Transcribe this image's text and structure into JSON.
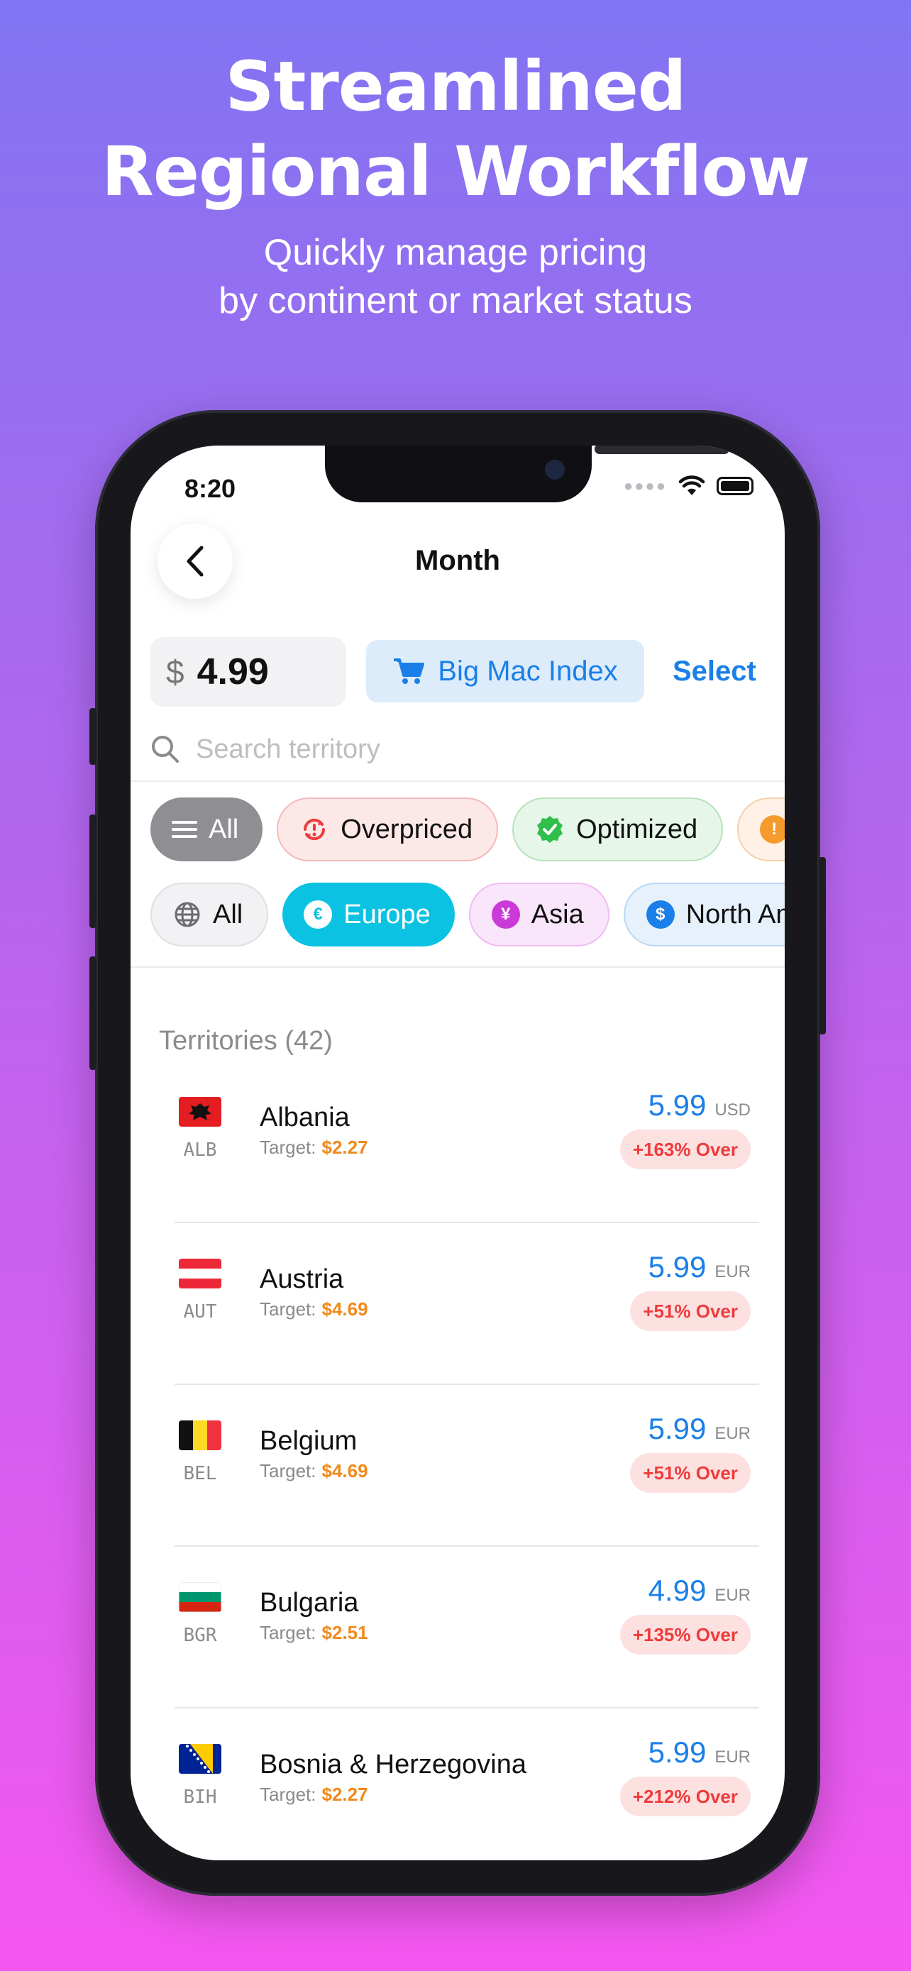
{
  "marketing": {
    "headline_line1": "Streamlined",
    "headline_line2": "Regional Workflow",
    "subline_line1": "Quickly manage pricing",
    "subline_line2": "by continent or market status"
  },
  "status_bar": {
    "time": "8:20"
  },
  "nav": {
    "title": "Month"
  },
  "price": {
    "currency_symbol": "$",
    "value": "4.99"
  },
  "big_mac_button": {
    "label": "Big Mac Index"
  },
  "select_button": {
    "label": "Select"
  },
  "search": {
    "placeholder": "Search territory"
  },
  "status_filters": [
    {
      "label": "All",
      "selected": true
    },
    {
      "label": "Overpriced"
    },
    {
      "label": "Optimized"
    }
  ],
  "region_filters": [
    {
      "label": "All"
    },
    {
      "label": "Europe",
      "selected": true,
      "icon_glyph": "€"
    },
    {
      "label": "Asia",
      "icon_glyph": "¥"
    },
    {
      "label": "North Am",
      "icon_glyph": "$"
    }
  ],
  "territories_header": "Territories (42)",
  "territories": [
    {
      "flag": "albania",
      "code": "ALB",
      "name": "Albania",
      "target_label": "Target:",
      "target": "$2.27",
      "price": "5.99",
      "currency": "USD",
      "status": "+163% Over"
    },
    {
      "flag": "austria",
      "code": "AUT",
      "name": "Austria",
      "target_label": "Target:",
      "target": "$4.69",
      "price": "5.99",
      "currency": "EUR",
      "status": "+51% Over"
    },
    {
      "flag": "belgium",
      "code": "BEL",
      "name": "Belgium",
      "target_label": "Target:",
      "target": "$4.69",
      "price": "5.99",
      "currency": "EUR",
      "status": "+51% Over"
    },
    {
      "flag": "bulgaria",
      "code": "BGR",
      "name": "Bulgaria",
      "target_label": "Target:",
      "target": "$2.51",
      "price": "4.99",
      "currency": "EUR",
      "status": "+135% Over"
    },
    {
      "flag": "bosnia",
      "code": "BIH",
      "name": "Bosnia & Herzegovina",
      "target_label": "Target:",
      "target": "$2.27",
      "price": "5.99",
      "currency": "EUR",
      "status": "+212% Over"
    }
  ],
  "colors": {
    "accent": "#1a7fe8",
    "target": "#f08a1c",
    "over_text": "#ef3b3b",
    "over_bg": "#fde1e1",
    "europe_chip": "#0cc2e3"
  }
}
